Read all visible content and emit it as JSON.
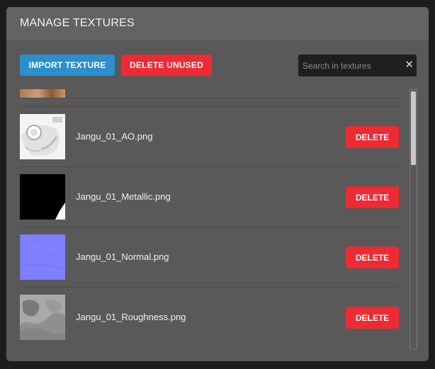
{
  "dialog": {
    "title": "MANAGE TEXTURES"
  },
  "toolbar": {
    "import_label": "IMPORT TEXTURE",
    "delete_unused_label": "DELETE UNUSED",
    "search_placeholder": "Search in textures",
    "search_value": "",
    "clear_icon": "close-icon"
  },
  "textures": [
    {
      "name": "Jangu_01_AO.png",
      "thumb": "ao",
      "delete_label": "DELETE"
    },
    {
      "name": "Jangu_01_Metallic.png",
      "thumb": "metallic",
      "delete_label": "DELETE"
    },
    {
      "name": "Jangu_01_Normal.png",
      "thumb": "normal",
      "delete_label": "DELETE"
    },
    {
      "name": "Jangu_01_Roughness.png",
      "thumb": "roughness",
      "delete_label": "DELETE"
    }
  ],
  "scroll": {
    "position_fraction": 0.0
  },
  "colors": {
    "import_button": "#2a8fcf",
    "delete_button": "#ee2a33",
    "dialog_bg": "#595959",
    "header_bg": "#636363"
  }
}
